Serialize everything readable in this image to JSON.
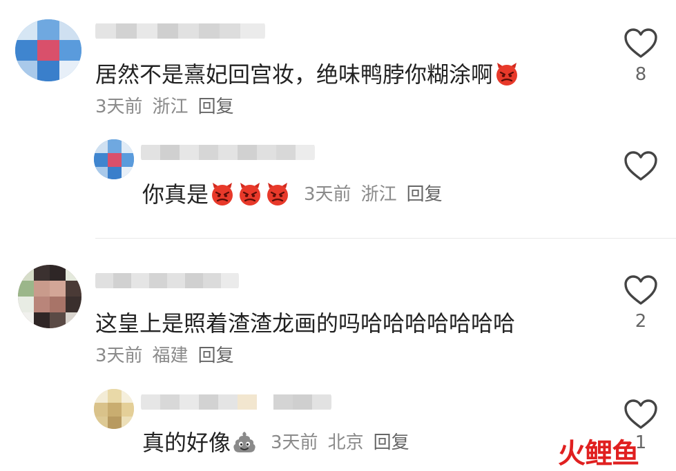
{
  "colors": {
    "text": "#222222",
    "meta": "#8a8a8a",
    "heart_outline": "#444444",
    "watermark": "#e02020"
  },
  "comments": [
    {
      "text": "居然不是熹妃回宫妆，绝味鸭脖你糊涂啊",
      "emoji": "angry-devil-emoji",
      "time": "3天前",
      "location": "浙江",
      "reply_label": "回复",
      "likes": "8",
      "reply": {
        "text": "你真是",
        "emoji_count": 3,
        "time": "3天前",
        "location": "浙江",
        "reply_label": "回复",
        "likes": ""
      }
    },
    {
      "text": "这皇上是照着渣渣龙画的吗哈哈哈哈哈哈哈",
      "time": "3天前",
      "location": "福建",
      "reply_label": "回复",
      "likes": "2",
      "reply": {
        "text": "真的好像",
        "emoji": "pile-of-poo-emoji",
        "time": "3天前",
        "location": "北京",
        "reply_label": "回复",
        "likes": "1"
      }
    }
  ],
  "watermark": {
    "text": "火鲤鱼"
  }
}
